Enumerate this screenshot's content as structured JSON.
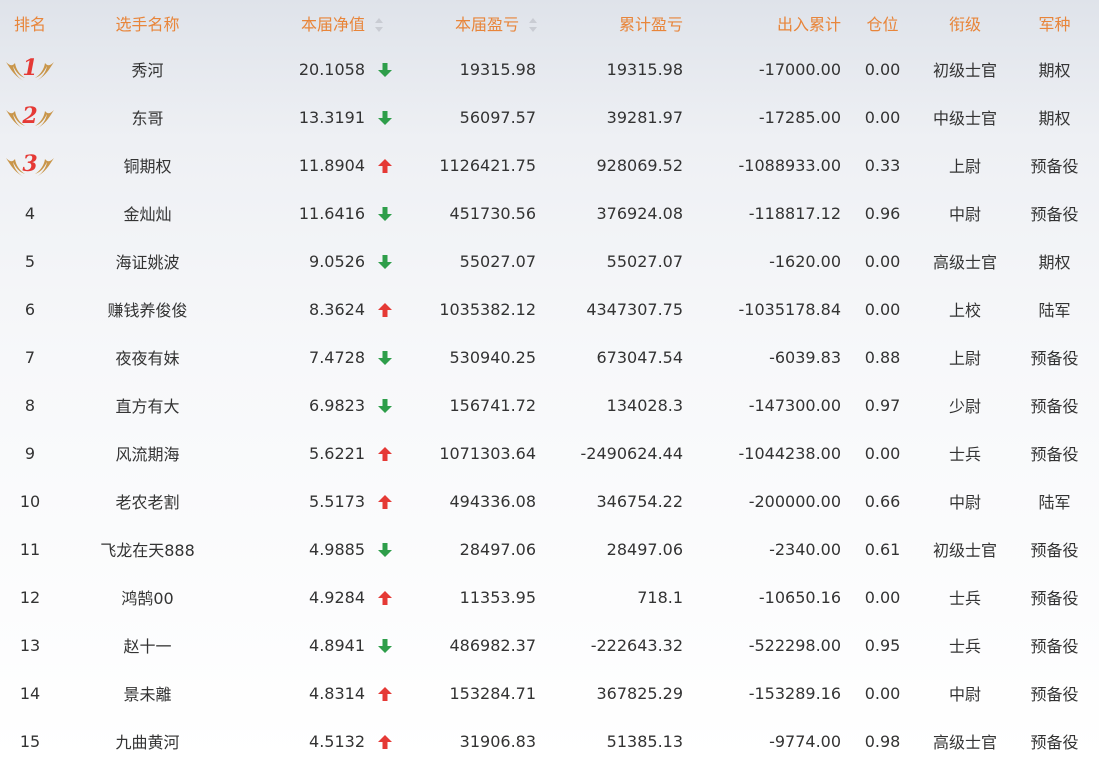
{
  "headers": {
    "rank": "排名",
    "name": "选手名称",
    "nav": "本届净值",
    "period_pl": "本届盈亏",
    "cumulative_pl": "累计盈亏",
    "inout": "出入累计",
    "position": "仓位",
    "title": "衔级",
    "branch": "军种"
  },
  "colors": {
    "header_text": "#e8853a",
    "up_arrow": "#e53935",
    "down_arrow": "#2e9e4a",
    "rank_number": "#e53935",
    "wing": "#c9964a"
  },
  "rows": [
    {
      "rank": "1",
      "name": "秀河",
      "nav": "20.1058",
      "trend": "down",
      "period_pl": "19315.98",
      "cumulative_pl": "19315.98",
      "inout": "-17000.00",
      "position": "0.00",
      "title": "初级士官",
      "branch": "期权"
    },
    {
      "rank": "2",
      "name": "东哥",
      "nav": "13.3191",
      "trend": "down",
      "period_pl": "56097.57",
      "cumulative_pl": "39281.97",
      "inout": "-17285.00",
      "position": "0.00",
      "title": "中级士官",
      "branch": "期权"
    },
    {
      "rank": "3",
      "name": "铜期权",
      "nav": "11.8904",
      "trend": "up",
      "period_pl": "1126421.75",
      "cumulative_pl": "928069.52",
      "inout": "-1088933.00",
      "position": "0.33",
      "title": "上尉",
      "branch": "预备役"
    },
    {
      "rank": "4",
      "name": "金灿灿",
      "nav": "11.6416",
      "trend": "down",
      "period_pl": "451730.56",
      "cumulative_pl": "376924.08",
      "inout": "-118817.12",
      "position": "0.96",
      "title": "中尉",
      "branch": "预备役"
    },
    {
      "rank": "5",
      "name": "海证姚波",
      "nav": "9.0526",
      "trend": "down",
      "period_pl": "55027.07",
      "cumulative_pl": "55027.07",
      "inout": "-1620.00",
      "position": "0.00",
      "title": "高级士官",
      "branch": "期权"
    },
    {
      "rank": "6",
      "name": "赚钱养俊俊",
      "nav": "8.3624",
      "trend": "up",
      "period_pl": "1035382.12",
      "cumulative_pl": "4347307.75",
      "inout": "-1035178.84",
      "position": "0.00",
      "title": "上校",
      "branch": "陆军"
    },
    {
      "rank": "7",
      "name": "夜夜有妹",
      "nav": "7.4728",
      "trend": "down",
      "period_pl": "530940.25",
      "cumulative_pl": "673047.54",
      "inout": "-6039.83",
      "position": "0.88",
      "title": "上尉",
      "branch": "预备役"
    },
    {
      "rank": "8",
      "name": "直方有大",
      "nav": "6.9823",
      "trend": "down",
      "period_pl": "156741.72",
      "cumulative_pl": "134028.3",
      "inout": "-147300.00",
      "position": "0.97",
      "title": "少尉",
      "branch": "预备役"
    },
    {
      "rank": "9",
      "name": "风流期海",
      "nav": "5.6221",
      "trend": "up",
      "period_pl": "1071303.64",
      "cumulative_pl": "-2490624.44",
      "inout": "-1044238.00",
      "position": "0.00",
      "title": "士兵",
      "branch": "预备役"
    },
    {
      "rank": "10",
      "name": "老农老割",
      "nav": "5.5173",
      "trend": "up",
      "period_pl": "494336.08",
      "cumulative_pl": "346754.22",
      "inout": "-200000.00",
      "position": "0.66",
      "title": "中尉",
      "branch": "陆军"
    },
    {
      "rank": "11",
      "name": "飞龙在天888",
      "nav": "4.9885",
      "trend": "down",
      "period_pl": "28497.06",
      "cumulative_pl": "28497.06",
      "inout": "-2340.00",
      "position": "0.61",
      "title": "初级士官",
      "branch": "预备役"
    },
    {
      "rank": "12",
      "name": "鸿鹄00",
      "nav": "4.9284",
      "trend": "up",
      "period_pl": "11353.95",
      "cumulative_pl": "718.1",
      "inout": "-10650.16",
      "position": "0.00",
      "title": "士兵",
      "branch": "预备役"
    },
    {
      "rank": "13",
      "name": "赵十一",
      "nav": "4.8941",
      "trend": "down",
      "period_pl": "486982.37",
      "cumulative_pl": "-222643.32",
      "inout": "-522298.00",
      "position": "0.95",
      "title": "士兵",
      "branch": "预备役"
    },
    {
      "rank": "14",
      "name": "景未離",
      "nav": "4.8314",
      "trend": "up",
      "period_pl": "153284.71",
      "cumulative_pl": "367825.29",
      "inout": "-153289.16",
      "position": "0.00",
      "title": "中尉",
      "branch": "预备役"
    },
    {
      "rank": "15",
      "name": "九曲黄河",
      "nav": "4.5132",
      "trend": "up",
      "period_pl": "31906.83",
      "cumulative_pl": "51385.13",
      "inout": "-9774.00",
      "position": "0.98",
      "title": "高级士官",
      "branch": "预备役"
    }
  ]
}
